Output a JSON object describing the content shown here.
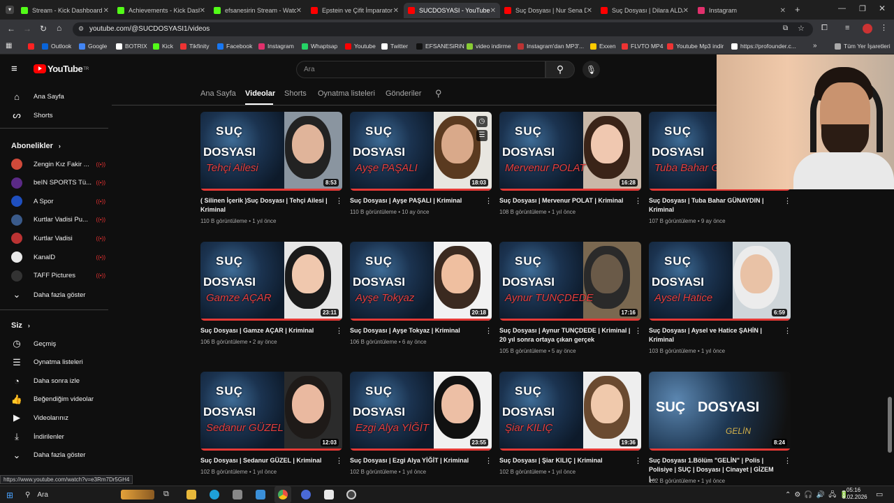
{
  "tabs": [
    {
      "title": "Stream - Kick Dashboard",
      "color": "#53fc18"
    },
    {
      "title": "Achievements - Kick Dash",
      "color": "#53fc18"
    },
    {
      "title": "efsanesirin Stream - Watc",
      "color": "#53fc18"
    },
    {
      "title": "Epstein ve Çifit İmparator",
      "color": "#ff0000"
    },
    {
      "title": "SUCDOSYASI - YouTube",
      "color": "#ff0000"
    },
    {
      "title": "Suç Dosyası | Nur Sena D",
      "color": "#ff0000"
    },
    {
      "title": "Suç Dosyası | Dilara ALDA",
      "color": "#ff0000"
    },
    {
      "title": "Instagram",
      "color": "#e1306c"
    }
  ],
  "url": "youtube.com/@SUCDOSYASI1/videos",
  "bookmarks": [
    "Outlook",
    "Google",
    "BOTRIX",
    "Kick",
    "Tikfinity",
    "Facebook",
    "Instagram",
    "Whaptsap",
    "Youtube",
    "Twitter",
    "EFSANESiRiN",
    "video indirme",
    "Instagram'dan MP3'...",
    "Exxen",
    "FLVTO MP4",
    "Youtube Mp3 indir",
    "https://profounder.c...",
    "Tüm Yer İşaretleri"
  ],
  "youtube": {
    "logo": "YouTube",
    "region": "TR",
    "search_placeholder": "Ara",
    "sidebar": {
      "home": "Ana Sayfa",
      "shorts": "Shorts",
      "subs_header": "Abonelikler",
      "channels": [
        {
          "name": "Zengin Kız Fakir ...",
          "color": "#d04a3a"
        },
        {
          "name": "beIN SPORTS Tü...",
          "color": "#5b2a86"
        },
        {
          "name": "A Spor",
          "color": "#1f4fbf"
        },
        {
          "name": "Kurtlar Vadisi Pu...",
          "color": "#3a5a8a"
        },
        {
          "name": "Kurtlar Vadisi",
          "color": "#b33"
        },
        {
          "name": "KanalD",
          "color": "#e8e8e8"
        },
        {
          "name": "TAFF Pictures",
          "color": "#333"
        }
      ],
      "show_more": "Daha fazla göster",
      "you_header": "Siz",
      "you_items": [
        "Geçmiş",
        "Oynatma listeleri",
        "Daha sonra izle",
        "Beğendiğim videolar",
        "Videolarınız",
        "İndirilenler",
        "Daha fazla göster"
      ]
    },
    "channel_tabs": [
      "Ana Sayfa",
      "Videolar",
      "Shorts",
      "Oynatma listeleri",
      "Gönderiler"
    ],
    "videos": [
      {
        "title": "( Silinen İçerik )Suç Dosyası | Tehçi Ailesi | Kriminal",
        "views": "110 B görüntüleme",
        "age": "1 yıl önce",
        "duration": "8:53",
        "name": "Tehçi Ailesi"
      },
      {
        "title": "Suç Dosyası | Ayşe PAŞALI | Kriminal",
        "views": "110 B görüntüleme",
        "age": "10 ay önce",
        "duration": "18:03",
        "name": "Ayşe PAŞALI"
      },
      {
        "title": "Suç Dosyası | Mervenur POLAT | Kriminal",
        "views": "108 B görüntüleme",
        "age": "1 yıl önce",
        "duration": "16:28",
        "name": "Mervenur POLAT"
      },
      {
        "title": "Suç Dosyası | Tuba Bahar GÜNAYDIN | Kriminal",
        "views": "107 B görüntüleme",
        "age": "9 ay önce",
        "duration": "",
        "name": "Tuba Bahar GÜNAYDIN"
      },
      {
        "title": "Suç Dosyası | Gamze AÇAR | Kriminal",
        "views": "106 B görüntüleme",
        "age": "2 ay önce",
        "duration": "23:11",
        "name": "Gamze AÇAR"
      },
      {
        "title": "Suç Dosyası | Ayşe Tokyaz | Kriminal",
        "views": "106 B görüntüleme",
        "age": "6 ay önce",
        "duration": "20:18",
        "name": "Ayşe Tokyaz"
      },
      {
        "title": "Suç Dosyası | Aynur TUNÇDEDE | Kriminal | 20 yıl sonra ortaya çıkan gerçek",
        "views": "105 B görüntüleme",
        "age": "5 ay önce",
        "duration": "17:16",
        "name": "Aynur TUNÇDEDE"
      },
      {
        "title": "Suç Dosyası | Aysel ve Hatice ŞAHİN | Kriminal",
        "views": "103 B görüntüleme",
        "age": "1 yıl önce",
        "duration": "6:59",
        "name": "Aysel Hatice"
      },
      {
        "title": "Suç Dosyası | Sedanur GÜZEL | Kriminal",
        "views": "102 B görüntüleme",
        "age": "1 yıl önce",
        "duration": "12:03",
        "name": "Sedanur GÜZEL"
      },
      {
        "title": "Suç Dosyası | Ezgi Alya YİĞİT | Kriminal",
        "views": "102 B görüntüleme",
        "age": "1 yıl önce",
        "duration": "23:55",
        "name": "Ezgi Alya YİĞİT"
      },
      {
        "title": "Suç Dosyası | Şiar KILIÇ | Kriminal",
        "views": "102 B görüntüleme",
        "age": "1 yıl önce",
        "duration": "19:36",
        "name": "Şiar KILIÇ"
      },
      {
        "title": "Suç Dosyası 1.Bölüm \"GELİN\" | Polis | Polisiye | SUÇ | Dosyası | Cinayet | GİZEM |...",
        "views": "102 B görüntüleme",
        "age": "1 yıl önce",
        "duration": "8:24",
        "name": "GELİN"
      }
    ],
    "thumb_logo": [
      "SUÇ",
      "DOSYASI"
    ]
  },
  "status_url": "https://www.youtube.com/watch?v=e3Rm7Dr5GH4",
  "taskbar": {
    "search": "Ara",
    "time": "05:16",
    "date": "8.02.2026"
  }
}
